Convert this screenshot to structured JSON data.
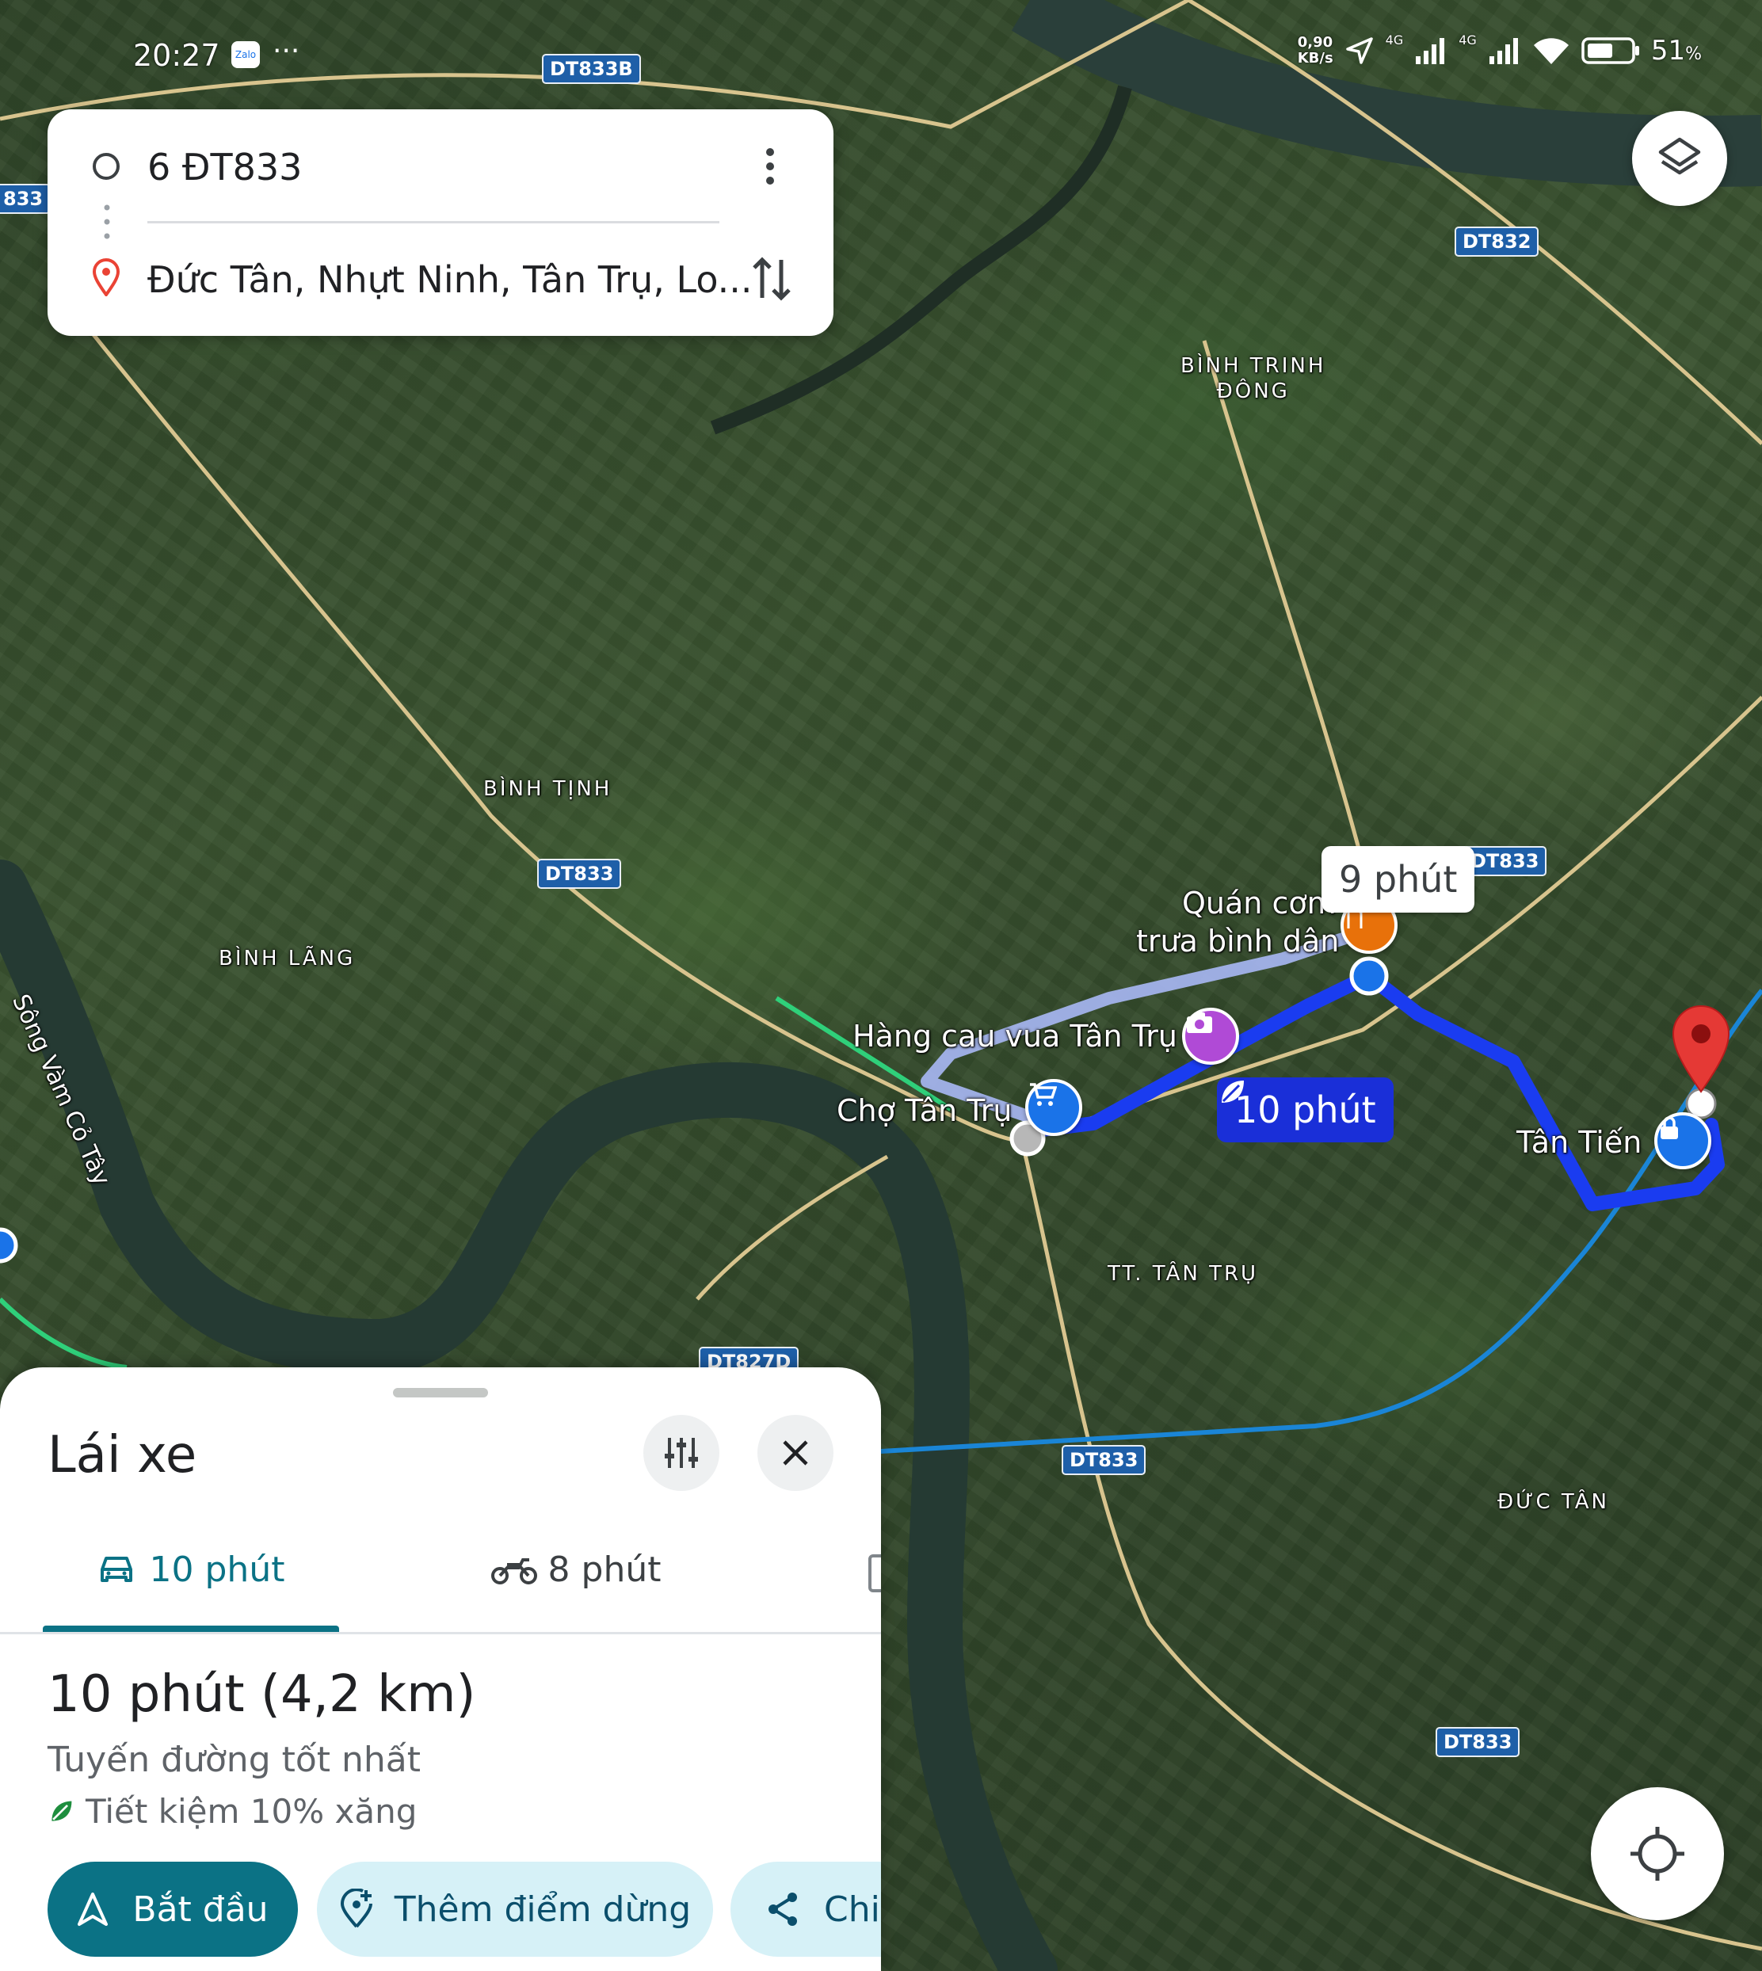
{
  "status_bar": {
    "time": "20:27",
    "app_badge": "Zalo",
    "more": "···",
    "speed_value": "0,90",
    "speed_unit": "KB/s",
    "net1": "4G",
    "net2": "4G",
    "battery": "51",
    "battery_unit": "%"
  },
  "search": {
    "origin": "6 ĐT833",
    "destination": "Đức Tân, Nhựt Ninh, Tân Trụ, Lo..."
  },
  "map": {
    "areas": {
      "binh_trinh_dong_1": "BÌNH TRINH",
      "binh_trinh_dong_2": "ĐÔNG",
      "binh_tinh": "BÌNH TỊNH",
      "binh_lang": "BÌNH LÃNG",
      "tt_tan_tru": "TT. TÂN TRỤ",
      "duc_tan": "ĐỨC TÂN",
      "river": "Sông Vàm Cỏ Tây"
    },
    "roads": {
      "dt833b": "DT833B",
      "dt833_left": "833",
      "dt832": "DT832",
      "dt833_a": "DT833",
      "dt833_b": "DT833",
      "dt833_c": "DT833",
      "dt833_d": "DT833",
      "dt827d": "DT827D"
    },
    "places": {
      "quan_com_1": "Quán cơm",
      "quan_com_2": "trưa bình dân",
      "hang_cau": "Hàng cau vua Tân Trụ",
      "cho": "Chợ Tân Trụ",
      "tan_tien": "Tân Tiến"
    },
    "callouts": {
      "alt_route": "9 phút",
      "main_route": "10 phút"
    }
  },
  "sheet": {
    "title": "Lái xe",
    "tabs": [
      {
        "label": "10 phút",
        "icon": "car-icon",
        "active": true
      },
      {
        "label": "8 phút",
        "icon": "motorbike-icon",
        "active": false
      }
    ],
    "summary": "10 phút (4,2 km)",
    "subtitle": "Tuyến đường tốt nhất",
    "eco": "Tiết kiệm 10% xăng",
    "buttons": {
      "start": "Bắt đầu",
      "add_stop": "Thêm điểm dừng",
      "share": "Chia"
    }
  },
  "colors": {
    "accent_teal": "#0b7285",
    "route_blue": "#1a3cf0",
    "pill_light": "#d6f1f7"
  }
}
